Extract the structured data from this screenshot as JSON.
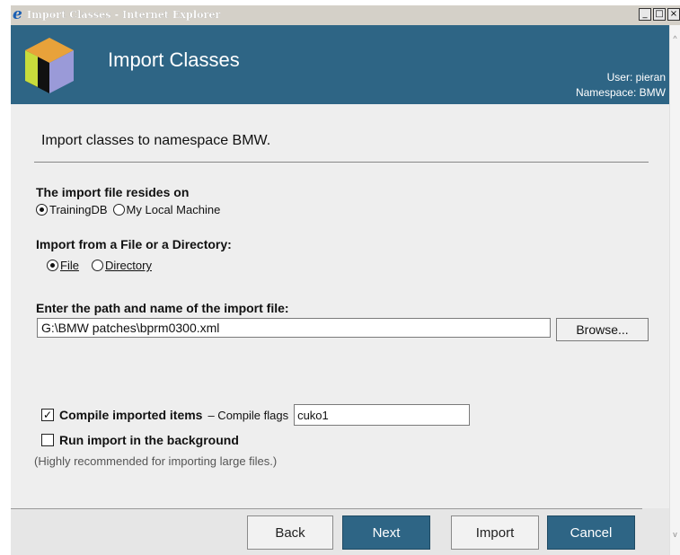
{
  "window": {
    "title": "Import Classes - Internet Explorer",
    "controls": [
      "_",
      "□",
      "×"
    ]
  },
  "header": {
    "title": "Import Classes",
    "user": "User: pieran",
    "namespace": "Namespace: BMW"
  },
  "intro": "Import classes to namespace BMW.",
  "import_source": {
    "label": "The import file resides on",
    "options": [
      {
        "label": "TrainingDB",
        "selected": true
      },
      {
        "label": "My Local Machine",
        "selected": false
      }
    ]
  },
  "import_type": {
    "label": "Import from a File or a Directory:",
    "options": [
      {
        "label": "File",
        "selected": true
      },
      {
        "label": "Directory",
        "selected": false
      }
    ]
  },
  "path": {
    "label": "Enter the path and name of the import file:",
    "value": "G:\\BMW patches\\bprm0300.xml",
    "browse_label": "Browse..."
  },
  "compile": {
    "checked": true,
    "label": "Compile imported items",
    "flags_label": "– Compile flags",
    "flags_value": "cuko1"
  },
  "background": {
    "checked": false,
    "label": "Run import in the background",
    "hint": "(Highly recommended for importing large files.)"
  },
  "buttons": {
    "back": "Back",
    "next": "Next",
    "import": "Import",
    "cancel": "Cancel"
  },
  "colors": {
    "header_bg": "#2e6585",
    "primary_button": "#2e6585",
    "content_bg": "#eeeeee"
  }
}
